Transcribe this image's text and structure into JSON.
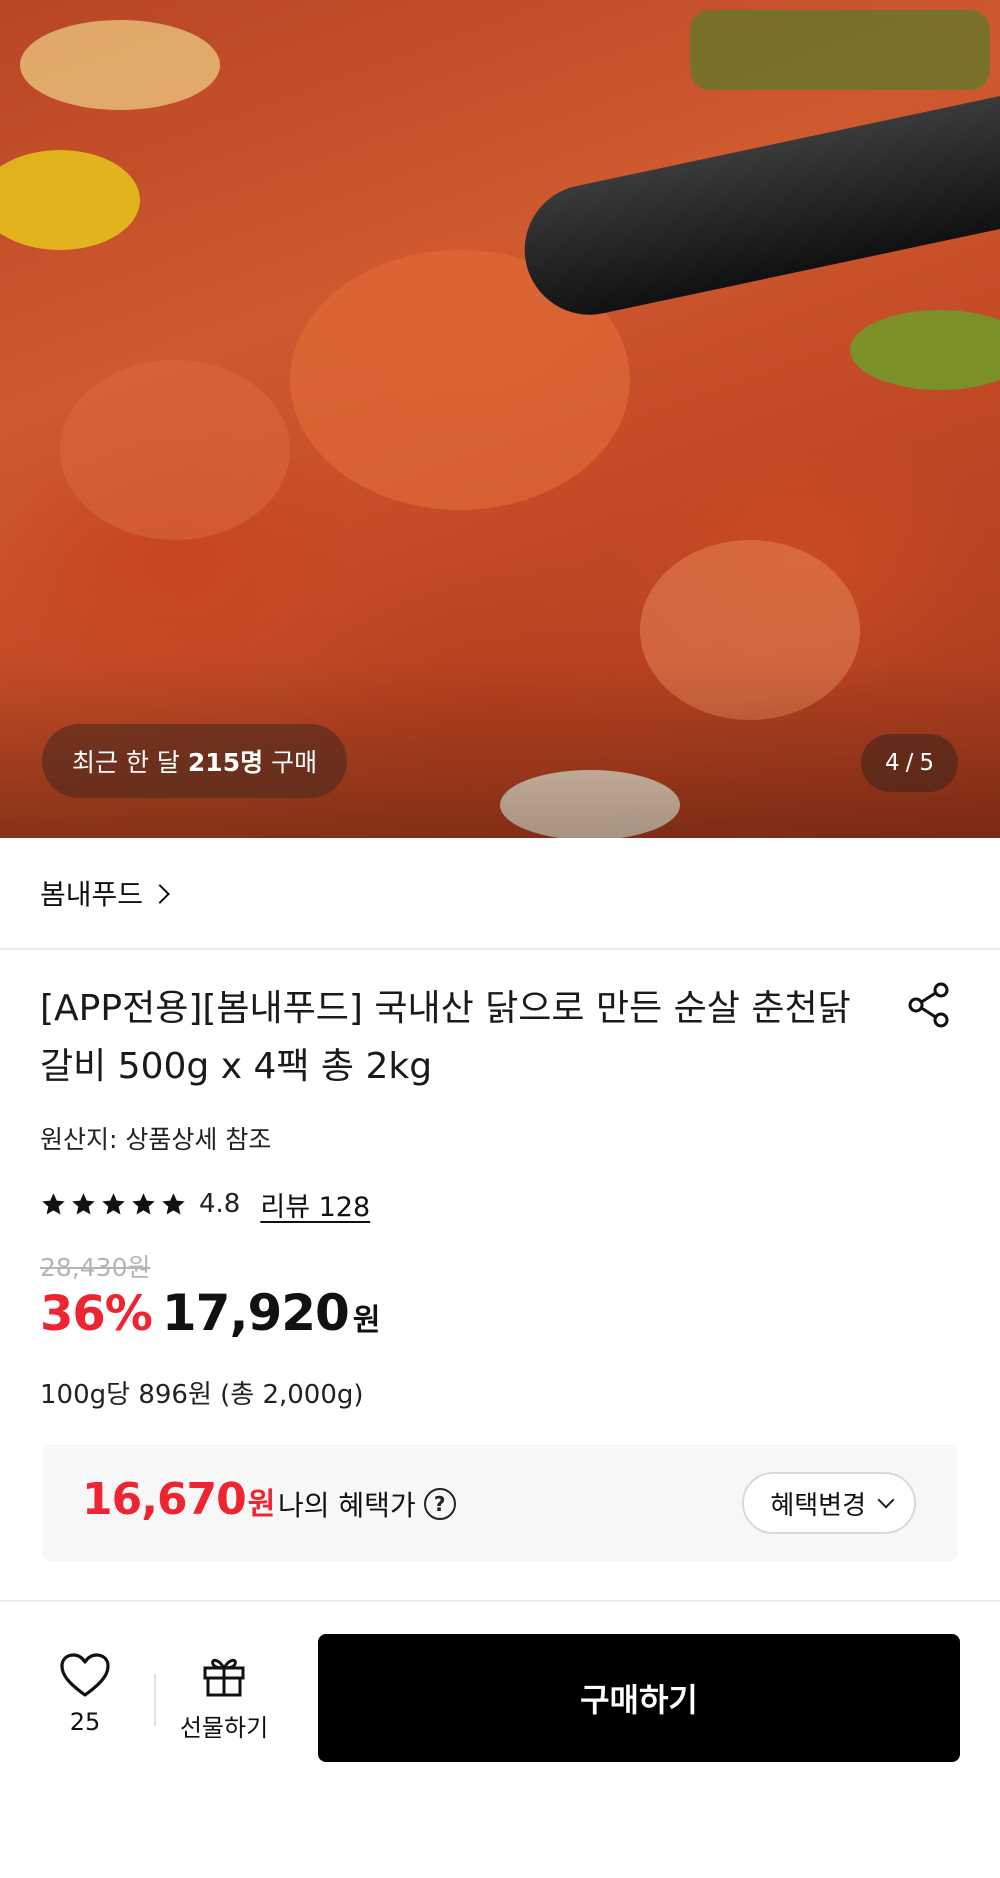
{
  "hero": {
    "image_desc": "spicy-chicken-photo",
    "purchase_prefix": "최근 한 달",
    "purchase_count": "215명",
    "purchase_suffix": "구매",
    "page_current": "4",
    "page_sep": "/",
    "page_total": "5"
  },
  "seller": {
    "name": "봄내푸드"
  },
  "product": {
    "title": "[APP전용][봄내푸드] 국내산 닭으로 만든 순살 춘천닭갈비 500g x 4팩 총 2kg",
    "origin": "원산지: 상품상세 참조",
    "rating": "4.8",
    "stars": 5,
    "review_label": "리뷰 128",
    "original_price": "28,430원",
    "discount": "36%",
    "price": "17,920",
    "price_unit": "원",
    "unit_price": "100g당 896원 (총 2,000g)"
  },
  "benefit": {
    "price": "16,670",
    "unit": "원",
    "label": "나의 혜택가",
    "help": "?",
    "change_label": "혜택변경"
  },
  "bottom_bar": {
    "like_count": "25",
    "gift_label": "선물하기",
    "buy_label": "구매하기"
  },
  "colors": {
    "accent_red": "#ee2431",
    "buy_button": "#000000"
  }
}
